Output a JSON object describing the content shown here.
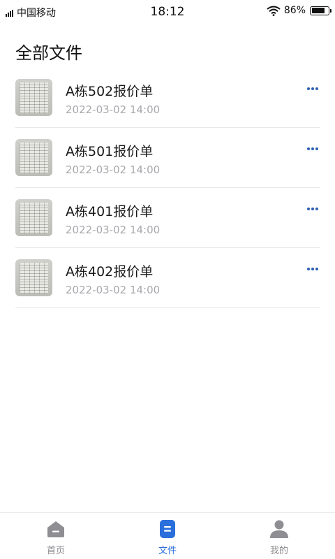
{
  "status_bar": {
    "carrier": "中国移动",
    "time": "18:12",
    "battery_text": "86%",
    "battery_level": 0.86
  },
  "page": {
    "title": "全部文件"
  },
  "files": [
    {
      "name": "A栋502报价单",
      "date": "2022-03-02 14:00"
    },
    {
      "name": "A栋501报价单",
      "date": "2022-03-02 14:00"
    },
    {
      "name": "A栋401报价单",
      "date": "2022-03-02 14:00"
    },
    {
      "name": "A栋402报价单",
      "date": "2022-03-02 14:00"
    }
  ],
  "tab_bar": {
    "items": [
      {
        "label": "首页",
        "icon": "home-icon",
        "active": false
      },
      {
        "label": "文件",
        "icon": "file-icon",
        "active": true
      },
      {
        "label": "我的",
        "icon": "user-icon",
        "active": false
      }
    ]
  },
  "colors": {
    "accent": "#2a6fdb",
    "more_dots": "#2d5fb5",
    "inactive_icon": "#8e8e93",
    "date_text": "#a8a8ad"
  }
}
